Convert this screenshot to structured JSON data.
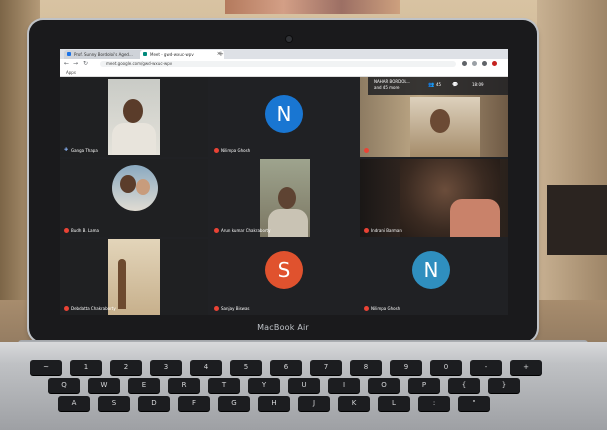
{
  "browser": {
    "tabs": [
      {
        "label": "Prof. Sunny Bordoloi's Aged..."
      },
      {
        "label": "Meet - gwd-wxuc-wpv"
      }
    ],
    "new_tab": "+",
    "url": "meet.google.com/gwd-wxuc-wpv",
    "apps_label": "Apps"
  },
  "meet": {
    "top_right": {
      "presenter": "NAHAR BORDOL...",
      "others": "and 45 more",
      "count": "45",
      "time": "18:09"
    },
    "participants": [
      {
        "name": "Ganga Thapa",
        "type": "video",
        "muted": false
      },
      {
        "name": "Nilimpa Ghosh",
        "type": "avatar",
        "initial": "N",
        "color": "blue",
        "muted": true
      },
      {
        "name": "Nahar Bordoloi",
        "type": "video",
        "muted": true
      },
      {
        "name": "Budh B. Lama",
        "type": "video",
        "muted": true
      },
      {
        "name": "Arun kumar Chakraborty",
        "type": "video",
        "muted": true
      },
      {
        "name": "Indrani Barman",
        "type": "video",
        "muted": true
      },
      {
        "name": "Debdatta Chakraborty",
        "type": "video",
        "muted": true
      },
      {
        "name": "Sanjay Biswas",
        "type": "avatar",
        "initial": "S",
        "color": "orange",
        "muted": true
      },
      {
        "name": "Nilimpa Ghosh",
        "type": "avatar",
        "initial": "N",
        "color": "lightblue",
        "muted": true
      }
    ]
  },
  "laptop": {
    "brand": "MacBook Air"
  },
  "keyboard": {
    "row1": [
      "~",
      "1",
      "2",
      "3",
      "4",
      "5",
      "6",
      "7",
      "8",
      "9",
      "0",
      "-",
      "+"
    ],
    "row2": [
      "Q",
      "W",
      "E",
      "R",
      "T",
      "Y",
      "U",
      "I",
      "O",
      "P",
      "{",
      "}"
    ],
    "row3": [
      "A",
      "S",
      "D",
      "F",
      "G",
      "H",
      "J",
      "K",
      "L",
      ":",
      "\""
    ]
  }
}
